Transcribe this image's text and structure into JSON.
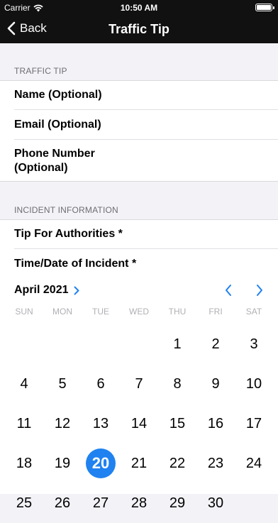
{
  "status": {
    "carrier": "Carrier",
    "time": "10:50 AM"
  },
  "nav": {
    "back_label": "Back",
    "title": "Traffic Tip"
  },
  "traffic_tip": {
    "header": "TRAFFIC TIP",
    "fields": [
      "Name (Optional)",
      "Email (Optional)",
      "Phone Number\n(Optional)"
    ]
  },
  "incident": {
    "header": "INCIDENT INFORMATION",
    "fields": [
      "Tip For Authorities *",
      "Time/Date of Incident *"
    ]
  },
  "calendar": {
    "month_label": "April 2021",
    "weekdays": [
      "SUN",
      "MON",
      "TUE",
      "WED",
      "THU",
      "FRI",
      "SAT"
    ],
    "days": [
      [
        "",
        "",
        "",
        "",
        "1",
        "2",
        "3"
      ],
      [
        "4",
        "5",
        "6",
        "7",
        "8",
        "9",
        "10"
      ],
      [
        "11",
        "12",
        "13",
        "14",
        "15",
        "16",
        "17"
      ],
      [
        "18",
        "19",
        "20",
        "21",
        "22",
        "23",
        "24"
      ],
      [
        "25",
        "26",
        "27",
        "28",
        "29",
        "30",
        ""
      ]
    ],
    "selected_day": "20",
    "accent": "#1f82f0"
  }
}
